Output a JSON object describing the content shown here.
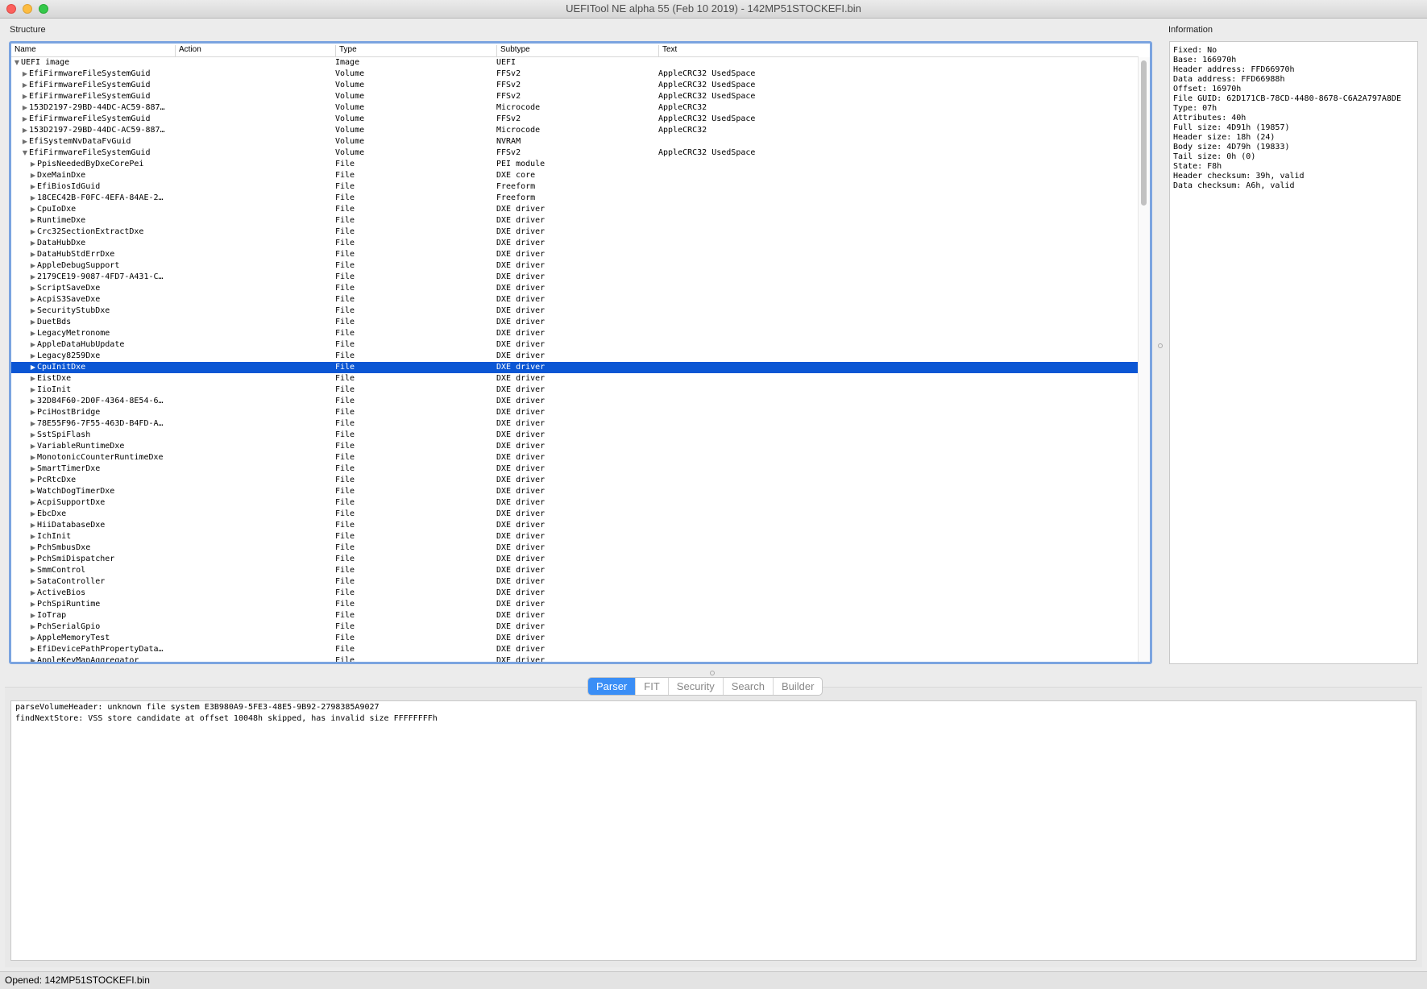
{
  "window": {
    "title": "UEFITool NE alpha 55 (Feb 10 2019) - 142MP51STOCKEFI.bin"
  },
  "structure": {
    "label": "Structure",
    "columns": [
      "Name",
      "Action",
      "Type",
      "Subtype",
      "Text"
    ],
    "rows": [
      {
        "name": "UEFI image",
        "type": "Image",
        "subtype": "UEFI",
        "text": "",
        "level": 0,
        "expanded": true,
        "selected": false
      },
      {
        "name": "EfiFirmwareFileSystemGuid",
        "type": "Volume",
        "subtype": "FFSv2",
        "text": "AppleCRC32 UsedSpace",
        "level": 1,
        "expanded": false,
        "selected": false
      },
      {
        "name": "EfiFirmwareFileSystemGuid",
        "type": "Volume",
        "subtype": "FFSv2",
        "text": "AppleCRC32 UsedSpace",
        "level": 1,
        "expanded": false,
        "selected": false
      },
      {
        "name": "EfiFirmwareFileSystemGuid",
        "type": "Volume",
        "subtype": "FFSv2",
        "text": "AppleCRC32 UsedSpace",
        "level": 1,
        "expanded": false,
        "selected": false
      },
      {
        "name": "153D2197-29BD-44DC-AC59-887…",
        "type": "Volume",
        "subtype": "Microcode",
        "text": "AppleCRC32",
        "level": 1,
        "expanded": false,
        "selected": false
      },
      {
        "name": "EfiFirmwareFileSystemGuid",
        "type": "Volume",
        "subtype": "FFSv2",
        "text": "AppleCRC32 UsedSpace",
        "level": 1,
        "expanded": false,
        "selected": false
      },
      {
        "name": "153D2197-29BD-44DC-AC59-887…",
        "type": "Volume",
        "subtype": "Microcode",
        "text": "AppleCRC32",
        "level": 1,
        "expanded": false,
        "selected": false
      },
      {
        "name": "EfiSystemNvDataFvGuid",
        "type": "Volume",
        "subtype": "NVRAM",
        "text": "",
        "level": 1,
        "expanded": false,
        "selected": false
      },
      {
        "name": "EfiFirmwareFileSystemGuid",
        "type": "Volume",
        "subtype": "FFSv2",
        "text": "AppleCRC32 UsedSpace",
        "level": 1,
        "expanded": true,
        "selected": false
      },
      {
        "name": "PpisNeededByDxeCorePei",
        "type": "File",
        "subtype": "PEI module",
        "text": "",
        "level": 2,
        "expanded": false,
        "selected": false
      },
      {
        "name": "DxeMainDxe",
        "type": "File",
        "subtype": "DXE core",
        "text": "",
        "level": 2,
        "expanded": false,
        "selected": false
      },
      {
        "name": "EfiBiosIdGuid",
        "type": "File",
        "subtype": "Freeform",
        "text": "",
        "level": 2,
        "expanded": false,
        "selected": false
      },
      {
        "name": "18CEC42B-F0FC-4EFA-84AE-2…",
        "type": "File",
        "subtype": "Freeform",
        "text": "",
        "level": 2,
        "expanded": false,
        "selected": false
      },
      {
        "name": "CpuIoDxe",
        "type": "File",
        "subtype": "DXE driver",
        "text": "",
        "level": 2,
        "expanded": false,
        "selected": false
      },
      {
        "name": "RuntimeDxe",
        "type": "File",
        "subtype": "DXE driver",
        "text": "",
        "level": 2,
        "expanded": false,
        "selected": false
      },
      {
        "name": "Crc32SectionExtractDxe",
        "type": "File",
        "subtype": "DXE driver",
        "text": "",
        "level": 2,
        "expanded": false,
        "selected": false
      },
      {
        "name": "DataHubDxe",
        "type": "File",
        "subtype": "DXE driver",
        "text": "",
        "level": 2,
        "expanded": false,
        "selected": false
      },
      {
        "name": "DataHubStdErrDxe",
        "type": "File",
        "subtype": "DXE driver",
        "text": "",
        "level": 2,
        "expanded": false,
        "selected": false
      },
      {
        "name": "AppleDebugSupport",
        "type": "File",
        "subtype": "DXE driver",
        "text": "",
        "level": 2,
        "expanded": false,
        "selected": false
      },
      {
        "name": "2179CE19-9087-4FD7-A431-C…",
        "type": "File",
        "subtype": "DXE driver",
        "text": "",
        "level": 2,
        "expanded": false,
        "selected": false
      },
      {
        "name": "ScriptSaveDxe",
        "type": "File",
        "subtype": "DXE driver",
        "text": "",
        "level": 2,
        "expanded": false,
        "selected": false
      },
      {
        "name": "AcpiS3SaveDxe",
        "type": "File",
        "subtype": "DXE driver",
        "text": "",
        "level": 2,
        "expanded": false,
        "selected": false
      },
      {
        "name": "SecurityStubDxe",
        "type": "File",
        "subtype": "DXE driver",
        "text": "",
        "level": 2,
        "expanded": false,
        "selected": false
      },
      {
        "name": "DuetBds",
        "type": "File",
        "subtype": "DXE driver",
        "text": "",
        "level": 2,
        "expanded": false,
        "selected": false
      },
      {
        "name": "LegacyMetronome",
        "type": "File",
        "subtype": "DXE driver",
        "text": "",
        "level": 2,
        "expanded": false,
        "selected": false
      },
      {
        "name": "AppleDataHubUpdate",
        "type": "File",
        "subtype": "DXE driver",
        "text": "",
        "level": 2,
        "expanded": false,
        "selected": false
      },
      {
        "name": "Legacy8259Dxe",
        "type": "File",
        "subtype": "DXE driver",
        "text": "",
        "level": 2,
        "expanded": false,
        "selected": false
      },
      {
        "name": "CpuInitDxe",
        "type": "File",
        "subtype": "DXE driver",
        "text": "",
        "level": 2,
        "expanded": false,
        "selected": true
      },
      {
        "name": "EistDxe",
        "type": "File",
        "subtype": "DXE driver",
        "text": "",
        "level": 2,
        "expanded": false,
        "selected": false
      },
      {
        "name": "IioInit",
        "type": "File",
        "subtype": "DXE driver",
        "text": "",
        "level": 2,
        "expanded": false,
        "selected": false
      },
      {
        "name": "32D84F60-2D0F-4364-8E54-6…",
        "type": "File",
        "subtype": "DXE driver",
        "text": "",
        "level": 2,
        "expanded": false,
        "selected": false
      },
      {
        "name": "PciHostBridge",
        "type": "File",
        "subtype": "DXE driver",
        "text": "",
        "level": 2,
        "expanded": false,
        "selected": false
      },
      {
        "name": "78E55F96-7F55-463D-B4FD-A…",
        "type": "File",
        "subtype": "DXE driver",
        "text": "",
        "level": 2,
        "expanded": false,
        "selected": false
      },
      {
        "name": "SstSpiFlash",
        "type": "File",
        "subtype": "DXE driver",
        "text": "",
        "level": 2,
        "expanded": false,
        "selected": false
      },
      {
        "name": "VariableRuntimeDxe",
        "type": "File",
        "subtype": "DXE driver",
        "text": "",
        "level": 2,
        "expanded": false,
        "selected": false
      },
      {
        "name": "MonotonicCounterRuntimeDxe",
        "type": "File",
        "subtype": "DXE driver",
        "text": "",
        "level": 2,
        "expanded": false,
        "selected": false
      },
      {
        "name": "SmartTimerDxe",
        "type": "File",
        "subtype": "DXE driver",
        "text": "",
        "level": 2,
        "expanded": false,
        "selected": false
      },
      {
        "name": "PcRtcDxe",
        "type": "File",
        "subtype": "DXE driver",
        "text": "",
        "level": 2,
        "expanded": false,
        "selected": false
      },
      {
        "name": "WatchDogTimerDxe",
        "type": "File",
        "subtype": "DXE driver",
        "text": "",
        "level": 2,
        "expanded": false,
        "selected": false
      },
      {
        "name": "AcpiSupportDxe",
        "type": "File",
        "subtype": "DXE driver",
        "text": "",
        "level": 2,
        "expanded": false,
        "selected": false
      },
      {
        "name": "EbcDxe",
        "type": "File",
        "subtype": "DXE driver",
        "text": "",
        "level": 2,
        "expanded": false,
        "selected": false
      },
      {
        "name": "HiiDatabaseDxe",
        "type": "File",
        "subtype": "DXE driver",
        "text": "",
        "level": 2,
        "expanded": false,
        "selected": false
      },
      {
        "name": "IchInit",
        "type": "File",
        "subtype": "DXE driver",
        "text": "",
        "level": 2,
        "expanded": false,
        "selected": false
      },
      {
        "name": "PchSmbusDxe",
        "type": "File",
        "subtype": "DXE driver",
        "text": "",
        "level": 2,
        "expanded": false,
        "selected": false
      },
      {
        "name": "PchSmiDispatcher",
        "type": "File",
        "subtype": "DXE driver",
        "text": "",
        "level": 2,
        "expanded": false,
        "selected": false
      },
      {
        "name": "SmmControl",
        "type": "File",
        "subtype": "DXE driver",
        "text": "",
        "level": 2,
        "expanded": false,
        "selected": false
      },
      {
        "name": "SataController",
        "type": "File",
        "subtype": "DXE driver",
        "text": "",
        "level": 2,
        "expanded": false,
        "selected": false
      },
      {
        "name": "ActiveBios",
        "type": "File",
        "subtype": "DXE driver",
        "text": "",
        "level": 2,
        "expanded": false,
        "selected": false
      },
      {
        "name": "PchSpiRuntime",
        "type": "File",
        "subtype": "DXE driver",
        "text": "",
        "level": 2,
        "expanded": false,
        "selected": false
      },
      {
        "name": "IoTrap",
        "type": "File",
        "subtype": "DXE driver",
        "text": "",
        "level": 2,
        "expanded": false,
        "selected": false
      },
      {
        "name": "PchSerialGpio",
        "type": "File",
        "subtype": "DXE driver",
        "text": "",
        "level": 2,
        "expanded": false,
        "selected": false
      },
      {
        "name": "AppleMemoryTest",
        "type": "File",
        "subtype": "DXE driver",
        "text": "",
        "level": 2,
        "expanded": false,
        "selected": false
      },
      {
        "name": "EfiDevicePathPropertyData…",
        "type": "File",
        "subtype": "DXE driver",
        "text": "",
        "level": 2,
        "expanded": false,
        "selected": false
      },
      {
        "name": "AppleKeyMapAggregator",
        "type": "File",
        "subtype": "DXE driver",
        "text": "",
        "level": 2,
        "expanded": false,
        "selected": false
      }
    ]
  },
  "information": {
    "label": "Information",
    "lines": [
      "Fixed: No",
      "Base: 166970h",
      "Header address: FFD66970h",
      "Data address: FFD66988h",
      "Offset: 16970h",
      "File GUID: 62D171CB-78CD-4480-8678-C6A2A797A8DE",
      "Type: 07h",
      "Attributes: 40h",
      "Full size: 4D91h (19857)",
      "Header size: 18h (24)",
      "Body size: 4D79h (19833)",
      "Tail size: 0h (0)",
      "State: F8h",
      "Header checksum: 39h, valid",
      "Data checksum: A6h, valid"
    ]
  },
  "tabs": [
    {
      "label": "Parser",
      "active": true
    },
    {
      "label": "FIT",
      "active": false
    },
    {
      "label": "Security",
      "active": false
    },
    {
      "label": "Search",
      "active": false
    },
    {
      "label": "Builder",
      "active": false
    }
  ],
  "messages": [
    "parseVolumeHeader: unknown file system E3B980A9-5FE3-48E5-9B92-2798385A9027",
    "findNextStore: VSS store candidate at offset 10048h skipped, has invalid size FFFFFFFFh"
  ],
  "status": {
    "text": "Opened: 142MP51STOCKEFI.bin"
  },
  "colors": {
    "selection": "#0b56d4",
    "active_tab": "#3a8ef6",
    "focus_border": "#7ba4e0"
  }
}
